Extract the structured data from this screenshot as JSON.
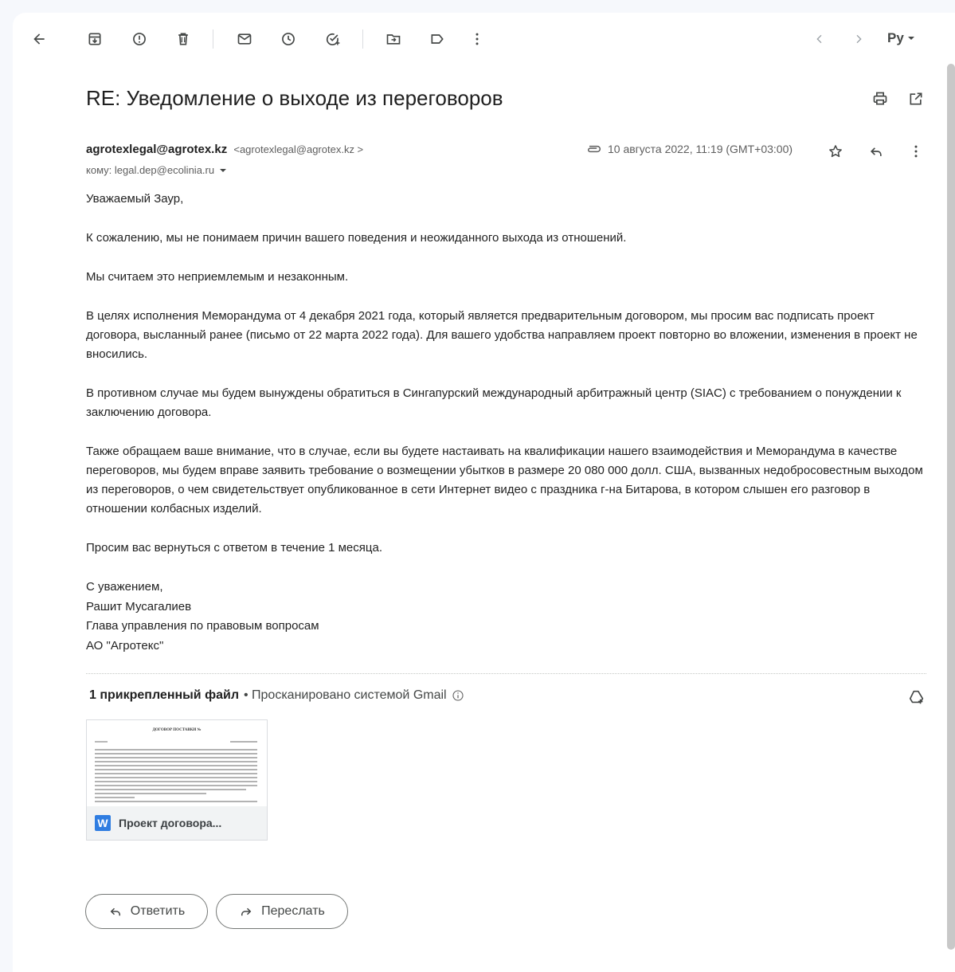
{
  "toolbar": {
    "icons": [
      "back-arrow-icon",
      "archive-icon",
      "report-spam-icon",
      "delete-icon",
      "mark-unread-icon",
      "snooze-icon",
      "add-task-icon",
      "move-to-icon",
      "label-icon",
      "more-vert-icon",
      "prev-icon",
      "next-icon",
      "language-icon"
    ],
    "language_label": "Ру"
  },
  "email": {
    "subject": "RE: Уведомление о выходе из переговоров",
    "sender_name": "agrotexlegal@agrotex.kz",
    "sender_email": "<agrotexlegal@agrotex.kz >",
    "to": "кому: legal.dep@ecolinia.ru",
    "date": "10 августа 2022, 11:19 (GMT+03:00)",
    "body": [
      "Уважаемый Заур,",
      "К сожалению, мы не понимаем причин вашего поведения и неожиданного выхода из отношений.",
      "Мы считаем это неприемлемым и незаконным.",
      "В целях исполнения Меморандума от 4 декабря 2021 года, который является предварительным договором, мы просим вас подписать проект договора, высланный ранее (письмо от 22 марта 2022 года). Для вашего удобства направляем проект повторно во вложении, изменения в проект не вносились.",
      "В противном случае мы будем вынуждены обратиться в Сингапурский международный арбитражный центр (SIAC) с требованием о понуждении к заключению договора.",
      "Также обращаем ваше внимание, что в случае, если вы будете настаивать на квалификации нашего взаимодействия и Меморандума в качестве переговоров, мы будем вправе заявить требование о возмещении убытков в размере 20 080 000 долл. США, вызванных недобросовестным выходом из переговоров, о чем свидетельствует опубликованное в сети Интернет видео с праздника г-на Битарова, в котором слышен его разговор в отношении колбасных изделий.",
      "Просим вас вернуться с ответом в течение 1 месяца."
    ],
    "signature": [
      "С уважением,",
      "Рашит Мусагалиев",
      "Глава управления по правовым вопросам",
      "АО \"Агротекс\""
    ]
  },
  "attachments": {
    "count_label": "1 прикрепленный файл",
    "scanned_label": "• Просканировано системой Gmail",
    "file_name": "Проект договора...",
    "preview_title": "ДОГОВОР ПОСТАВКИ №",
    "file_type_letter": "W"
  },
  "actions": {
    "reply_label": "Ответить",
    "forward_label": "Переслать"
  },
  "colors": {
    "background": "#f6f8fc",
    "icon": "#444746",
    "word_blue": "#2f7de1"
  }
}
